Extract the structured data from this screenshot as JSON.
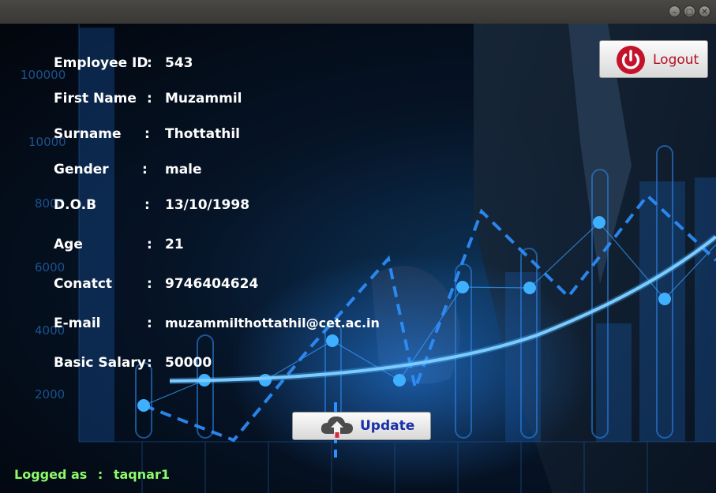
{
  "window": {
    "controls": [
      "minimize",
      "maximize",
      "close"
    ]
  },
  "background": {
    "axis_ticks": [
      "100000",
      "10000",
      "8000",
      "6000",
      "4000",
      "2000"
    ]
  },
  "profile": {
    "colon": ":",
    "fields": [
      {
        "label": "Employee ID",
        "value": "543"
      },
      {
        "label": "First Name",
        "value": "Muzammil"
      },
      {
        "label": "Surname",
        "value": "Thottathil"
      },
      {
        "label": "Gender",
        "value": "male"
      },
      {
        "label": "D.O.B",
        "value": "13/10/1998"
      },
      {
        "label": "Age",
        "value": "21"
      },
      {
        "label": "Conatct",
        "value": "9746404624"
      },
      {
        "label": "E-mail",
        "value": "muzammilthottathil@cet.ac.in"
      },
      {
        "label": "Basic Salary",
        "value": "50000"
      }
    ]
  },
  "logout_button": {
    "label": "Logout",
    "icon": "power-icon",
    "color": "#b50f23"
  },
  "update_button": {
    "label": "Update",
    "icon": "cloud-upload-icon",
    "color": "#1a2fa6"
  },
  "status": {
    "label": "Logged as",
    "colon": ":",
    "user": "taqnar1",
    "color": "#8dfb6a"
  }
}
